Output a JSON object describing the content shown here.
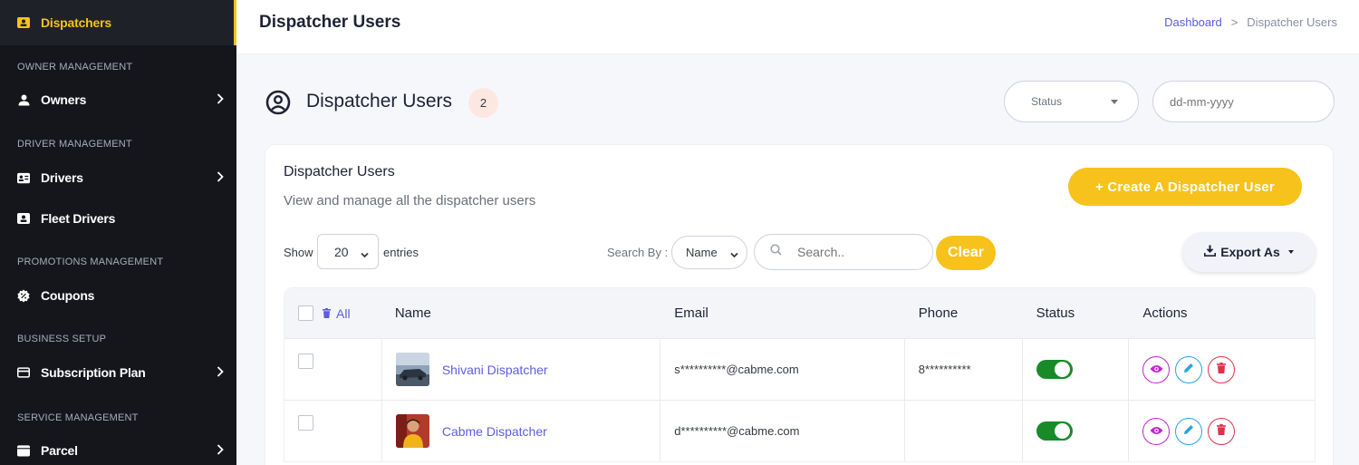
{
  "sidebar": {
    "items": [
      {
        "label": "Dispatchers"
      },
      {
        "label": "Owners"
      },
      {
        "label": "Drivers"
      },
      {
        "label": "Fleet Drivers"
      },
      {
        "label": "Coupons"
      },
      {
        "label": "Subscription Plan"
      },
      {
        "label": "Parcel"
      }
    ],
    "sections": [
      "OWNER MANAGEMENT",
      "DRIVER MANAGEMENT",
      "PROMOTIONS MANAGEMENT",
      "BUSINESS SETUP",
      "SERVICE MANAGEMENT"
    ]
  },
  "header": {
    "title": "Dispatcher Users",
    "breadcrumb": [
      "Dashboard",
      "Dispatcher Users"
    ],
    "breadcrumb_sep": ">"
  },
  "main": {
    "title": "Dispatcher Users",
    "count": "2",
    "status_select": "Status",
    "date_placeholder": "dd-mm-yyyy"
  },
  "card": {
    "title": "Dispatcher Users",
    "subtitle": "View and manage all the dispatcher users",
    "create_button": "+  Create A Dispatcher User",
    "show_label": "Show",
    "entries_value": "20",
    "entries_label": "entries",
    "search_by_label": "Search By :",
    "search_by_value": "Name",
    "search_placeholder": "Search..",
    "clear_button": "Clear",
    "export_button": "Export As"
  },
  "table": {
    "all_label": "All",
    "headers": [
      "Name",
      "Email",
      "Phone",
      "Status",
      "Actions"
    ],
    "rows": [
      {
        "name": "Shivani Dispatcher",
        "email": "s**********@cabme.com",
        "phone": "8**********",
        "status": "on"
      },
      {
        "name": "Cabme Dispatcher",
        "email": "d**********@cabme.com",
        "phone": "",
        "status": "on"
      }
    ]
  },
  "colors": {
    "accent": "#f6c21b",
    "sidebar_bg": "#14161c",
    "link": "#5b5ee0",
    "toggle_on": "#198a28"
  }
}
